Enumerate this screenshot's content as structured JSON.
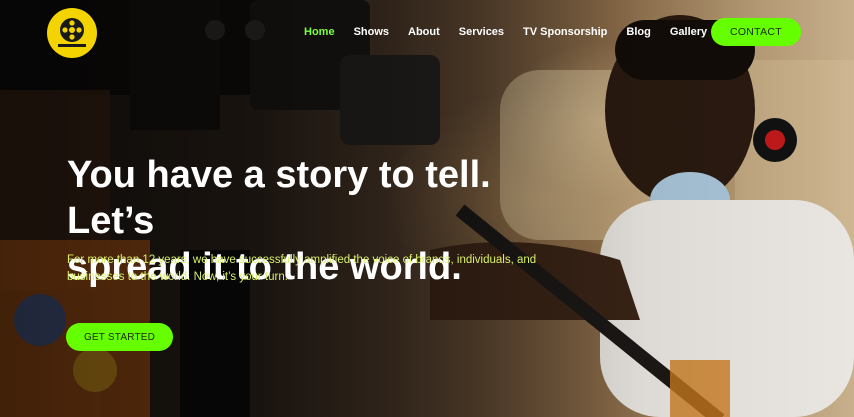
{
  "nav": {
    "items": [
      {
        "label": "Home",
        "active": true
      },
      {
        "label": "Shows",
        "active": false
      },
      {
        "label": "About",
        "active": false
      },
      {
        "label": "Services",
        "active": false
      },
      {
        "label": "TV Sponsorship",
        "active": false
      },
      {
        "label": "Blog",
        "active": false
      },
      {
        "label": "Gallery",
        "active": false
      }
    ],
    "contact_label": "CONTACT"
  },
  "hero": {
    "headline_line1": "You have a story to tell. Let’s",
    "headline_line2": "spread it to the world.",
    "subtext_line1": "For more than 12 years, we have successfully amplified the voice of brands, individuals, and",
    "subtext_line2": "businesses to the world. Now, it’s your turn.",
    "cta_label": "GET STARTED"
  },
  "colors": {
    "accent": "#66ff00",
    "active_nav": "#7dff3d",
    "subtext": "#d8f06a",
    "logo_bg": "#f3d400"
  },
  "icons": {
    "logo": "film-reel-logo"
  }
}
